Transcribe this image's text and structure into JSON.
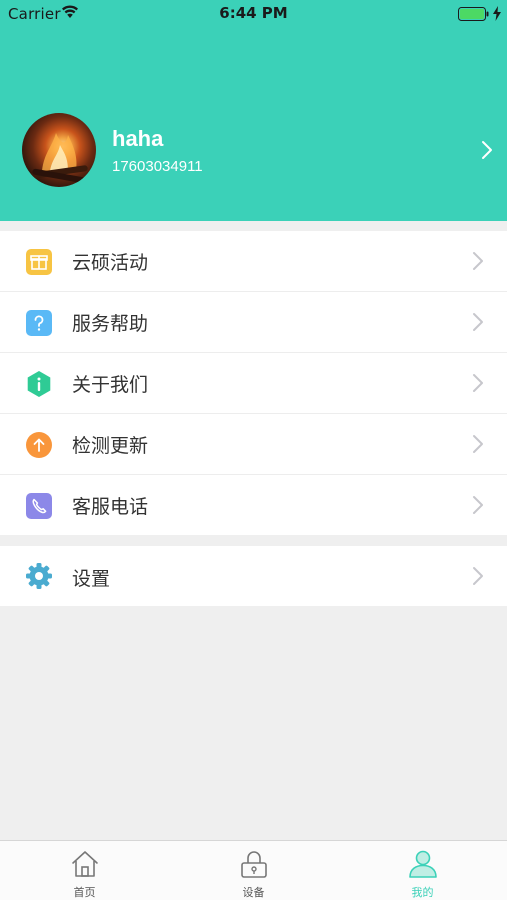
{
  "status_bar": {
    "carrier": "Carrier",
    "time": "6:44 PM",
    "wifi_icon": "wifi-icon",
    "battery_icon": "battery-icon",
    "battery_color": "#4cd964"
  },
  "theme": {
    "accent": "#3bd1b8",
    "background": "#efefef"
  },
  "profile": {
    "name": "haha",
    "phone": "17603034911",
    "avatar": "avatar-photo-fire",
    "chevron_icon": "chevron-right-icon"
  },
  "menu": {
    "items": [
      {
        "label": "云硕活动",
        "icon": "gift-icon",
        "color": "#f7c443"
      },
      {
        "label": "服务帮助",
        "icon": "question-icon",
        "color": "#5ab9f6"
      },
      {
        "label": "关于我们",
        "icon": "info-hexagon-icon",
        "color": "#2fcb95"
      },
      {
        "label": "检测更新",
        "icon": "upload-arrow-icon",
        "color": "#f9963b"
      },
      {
        "label": "客服电话",
        "icon": "phone-icon",
        "color": "#8c88e8"
      }
    ],
    "settings": {
      "label": "设置",
      "icon": "gear-icon",
      "color": "#4aabd0"
    }
  },
  "tabbar": {
    "tabs": [
      {
        "label": "首页",
        "icon": "home-icon"
      },
      {
        "label": "设备",
        "icon": "lock-icon"
      },
      {
        "label": "我的",
        "icon": "person-icon",
        "active": true
      }
    ]
  }
}
